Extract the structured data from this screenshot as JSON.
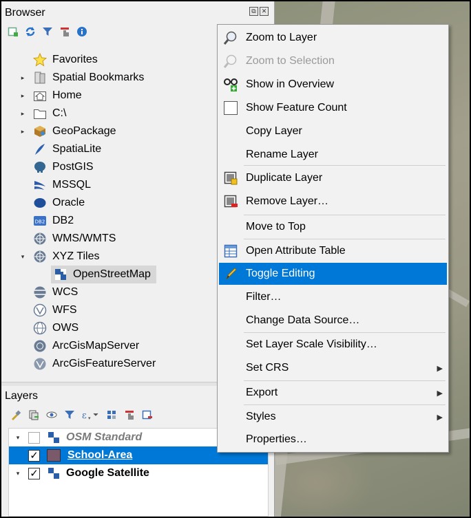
{
  "browser": {
    "title": "Browser",
    "dock_buttons": [
      "⧉",
      "✕"
    ],
    "toolbar_icons": [
      "add-layer-icon",
      "refresh-icon",
      "filter-icon",
      "collapse-all-icon",
      "info-icon"
    ],
    "items": [
      {
        "label": "Favorites",
        "icon": "star-icon",
        "expand": "",
        "indent": 0
      },
      {
        "label": "Spatial Bookmarks",
        "icon": "bookmark-icon",
        "expand": "▸",
        "indent": 0
      },
      {
        "label": "Home",
        "icon": "home-folder-icon",
        "expand": "▸",
        "indent": 0
      },
      {
        "label": "C:\\",
        "icon": "drive-folder-icon",
        "expand": "▸",
        "indent": 0
      },
      {
        "label": "GeoPackage",
        "icon": "geopackage-icon",
        "expand": "▸",
        "indent": 0
      },
      {
        "label": "SpatiaLite",
        "icon": "spatialite-icon",
        "expand": "",
        "indent": 0
      },
      {
        "label": "PostGIS",
        "icon": "postgis-icon",
        "expand": "",
        "indent": 0
      },
      {
        "label": "MSSQL",
        "icon": "mssql-icon",
        "expand": "",
        "indent": 0
      },
      {
        "label": "Oracle",
        "icon": "oracle-icon",
        "expand": "",
        "indent": 0
      },
      {
        "label": "DB2",
        "icon": "db2-icon",
        "expand": "",
        "indent": 0
      },
      {
        "label": "WMS/WMTS",
        "icon": "wms-globe-icon",
        "expand": "",
        "indent": 0
      },
      {
        "label": "XYZ Tiles",
        "icon": "xyz-globe-icon",
        "expand": "▾",
        "indent": 0
      },
      {
        "label": "OpenStreetMap",
        "icon": "xyz-tile-icon",
        "expand": "",
        "indent": 1
      },
      {
        "label": "WCS",
        "icon": "wcs-globe-icon",
        "expand": "",
        "indent": 0
      },
      {
        "label": "WFS",
        "icon": "wfs-globe-icon",
        "expand": "",
        "indent": 0
      },
      {
        "label": "OWS",
        "icon": "ows-globe-icon",
        "expand": "",
        "indent": 0
      },
      {
        "label": "ArcGisMapServer",
        "icon": "arcgis-map-icon",
        "expand": "",
        "indent": 0
      },
      {
        "label": "ArcGisFeatureServer",
        "icon": "arcgis-feature-icon",
        "expand": "",
        "indent": 0
      }
    ]
  },
  "layers": {
    "title": "Layers",
    "toolbar_icons": [
      "style-icon",
      "add-group-icon",
      "manage-visibility-icon",
      "filter-legend-icon",
      "expression-filter-icon",
      "expand-all-icon",
      "collapse-all-icon",
      "remove-layer-icon"
    ],
    "items": [
      {
        "label": "OSM Standard",
        "checked": false,
        "expand": "▾",
        "style": "italic-gray"
      },
      {
        "label": "School-Area",
        "checked": true,
        "expand": "",
        "style": "selected"
      },
      {
        "label": "Google Satellite",
        "checked": true,
        "expand": "▾",
        "style": "bold"
      }
    ]
  },
  "context_menu": {
    "items": [
      {
        "label": "Zoom to Layer",
        "icon": "zoom-layer-icon",
        "enabled": true
      },
      {
        "label": "Zoom to Selection",
        "icon": "zoom-selection-icon",
        "enabled": false
      },
      {
        "label": "Show in Overview",
        "icon": "overview-icon",
        "enabled": true
      },
      {
        "label": "Show Feature Count",
        "icon": "checkbox",
        "enabled": true
      },
      {
        "label": "Copy Layer",
        "icon": "",
        "enabled": true
      },
      {
        "label": "Rename Layer",
        "icon": "",
        "enabled": true
      },
      {
        "label": "Duplicate Layer",
        "icon": "duplicate-layer-icon",
        "enabled": true
      },
      {
        "label": "Remove Layer…",
        "icon": "remove-layer-icon",
        "enabled": true
      },
      {
        "label": "Move to Top",
        "icon": "",
        "enabled": true
      },
      {
        "label": "Open Attribute Table",
        "icon": "attribute-table-icon",
        "enabled": true
      },
      {
        "label": "Toggle Editing",
        "icon": "pencil-icon",
        "enabled": true,
        "highlighted": true
      },
      {
        "label": "Filter…",
        "icon": "",
        "enabled": true
      },
      {
        "label": "Change Data Source…",
        "icon": "",
        "enabled": true
      },
      {
        "label": "Set Layer Scale Visibility…",
        "icon": "",
        "enabled": true
      },
      {
        "label": "Set CRS",
        "icon": "",
        "enabled": true,
        "submenu": true
      },
      {
        "label": "Export",
        "icon": "",
        "enabled": true,
        "submenu": true
      },
      {
        "label": "Styles",
        "icon": "",
        "enabled": true,
        "submenu": true
      },
      {
        "label": "Properties…",
        "icon": "",
        "enabled": true
      }
    ]
  },
  "colors": {
    "highlight": "#0078d7",
    "panel_bg": "#f0f0f0",
    "disabled_text": "#9a9a9a",
    "school_area_fill": "#7a5a6a"
  }
}
